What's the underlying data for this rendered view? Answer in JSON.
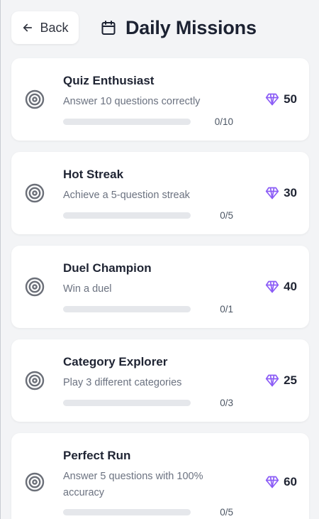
{
  "header": {
    "back_label": "Back",
    "title": "Daily Missions"
  },
  "colors": {
    "background": "#f3f4f6",
    "card": "#ffffff",
    "gem": "#8b5cf6",
    "track": "#e5e7eb"
  },
  "missions": [
    {
      "title": "Quiz Enthusiast",
      "description": "Answer 10 questions correctly",
      "progress_text": "0/10",
      "progress": 0,
      "reward": "50"
    },
    {
      "title": "Hot Streak",
      "description": "Achieve a 5-question streak",
      "progress_text": "0/5",
      "progress": 0,
      "reward": "30"
    },
    {
      "title": "Duel Champion",
      "description": "Win a duel",
      "progress_text": "0/1",
      "progress": 0,
      "reward": "40"
    },
    {
      "title": "Category Explorer",
      "description": "Play 3 different categories",
      "progress_text": "0/3",
      "progress": 0,
      "reward": "25"
    },
    {
      "title": "Perfect Run",
      "description": "Answer 5 questions with 100% accuracy",
      "progress_text": "0/5",
      "progress": 0,
      "reward": "60"
    }
  ],
  "icons": {
    "back": "arrow-left-icon",
    "title": "calendar-icon",
    "mission": "target-icon",
    "reward": "gem-icon"
  }
}
